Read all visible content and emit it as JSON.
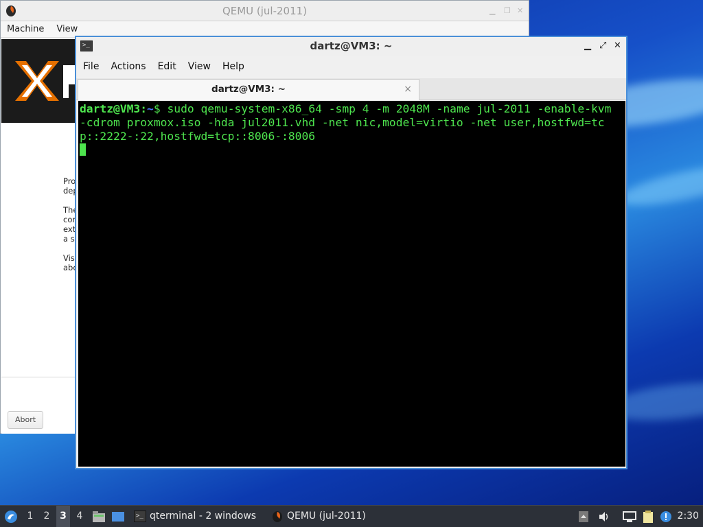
{
  "qemu_window": {
    "title": "QEMU (jul-2011)",
    "menu": [
      "Machine",
      "View"
    ],
    "installer": {
      "paragraphs": [
        "Pro",
        "dep",
        "The",
        "con",
        "ext",
        "a s",
        "Visi",
        "abo"
      ],
      "abort_label": "Abort"
    }
  },
  "terminal_window": {
    "title": "dartz@VM3: ~",
    "menu": [
      "File",
      "Actions",
      "Edit",
      "View",
      "Help"
    ],
    "tab": {
      "label": "dartz@VM3: ~",
      "close": "×"
    },
    "terminal": {
      "prompt_user": "dartz@VM3",
      "prompt_sep": ":",
      "prompt_path": "~",
      "prompt_symbol": "$",
      "command": " sudo qemu-system-x86_64 -smp 4 -m 2048M -name jul-2011 -enable-kvm -cdrom proxmox.iso -hda jul2011.vhd -net nic,model=virtio -net user,hostfwd=tcp::2222-:22,hostfwd=tcp::8006-:8006"
    }
  },
  "taskbar": {
    "workspaces": [
      "1",
      "2",
      "3",
      "4"
    ],
    "active_workspace": "3",
    "tasks": [
      {
        "label": "qterminal - 2 windows",
        "icon": "terminal-icon"
      },
      {
        "label": "QEMU (jul-2011)",
        "icon": "qemu-icon"
      }
    ],
    "clock": "2:30"
  },
  "colors": {
    "terminal_text": "#4ee44e",
    "terminal_bg": "#000000",
    "window_focus_border": "#4a8fd8",
    "taskbar_bg": "#2c3038"
  }
}
